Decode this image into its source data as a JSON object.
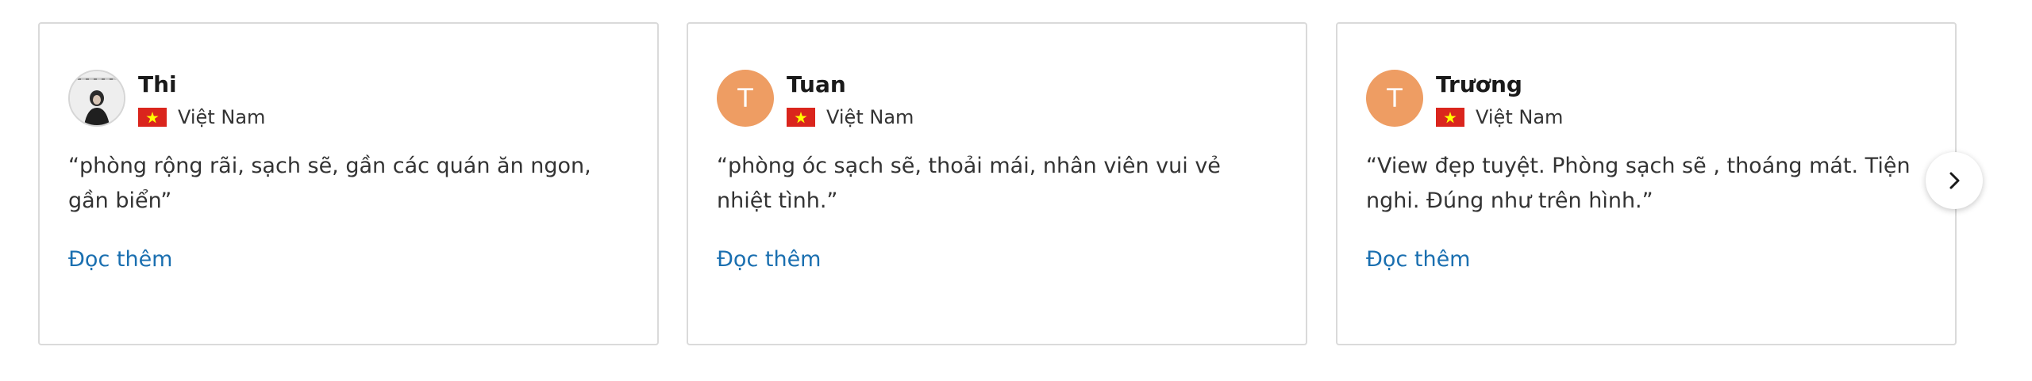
{
  "reviews": [
    {
      "name": "Thi",
      "country": "Việt Nam",
      "avatar": {
        "type": "photo"
      },
      "text": "“phòng rộng rãi, sạch sẽ, gần các quán ăn ngon, gần biển”",
      "read_more": "Đọc thêm"
    },
    {
      "name": "Tuan",
      "country": "Việt Nam",
      "avatar": {
        "type": "letter",
        "letter": "T"
      },
      "text": "“phòng óc sạch sẽ, thoải mái, nhân viên vui vẻ nhiệt tình.”",
      "read_more": "Đọc thêm"
    },
    {
      "name": "Trương",
      "country": "Việt Nam",
      "avatar": {
        "type": "letter",
        "letter": "T"
      },
      "text": "“View đẹp tuyệt. Phòng sạch sẽ , thoáng mát. Tiện nghi. Đúng như trên hình.”",
      "read_more": "Đọc thêm"
    }
  ],
  "next_button": {
    "icon": "chevron-right-icon"
  },
  "colors": {
    "avatar_bg": "#ee9d63",
    "link": "#1a6fb0",
    "border": "#dadada",
    "flag_red": "#da251d",
    "flag_star": "#ffff00"
  }
}
